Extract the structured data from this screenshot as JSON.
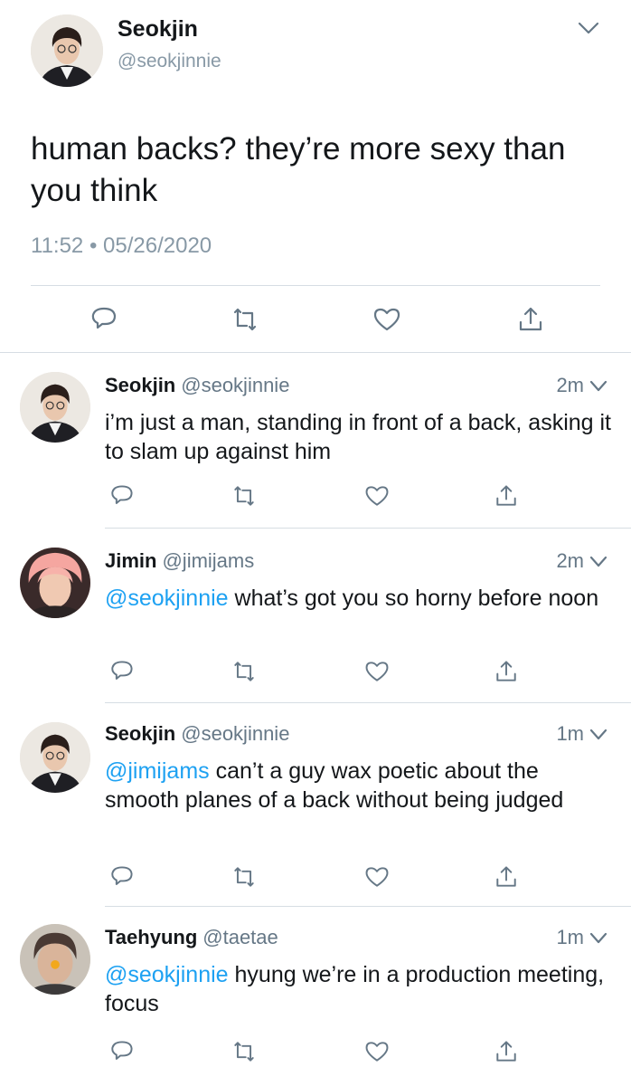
{
  "main_tweet": {
    "name": "Seokjin",
    "handle": "@seokjinnie",
    "text": "human backs? they’re more sexy than you think",
    "timestamp": "11:52 • 05/26/2020",
    "avatar_icon": "avatar-seokjin"
  },
  "replies": [
    {
      "name": "Seokjin",
      "handle": "@seokjinnie",
      "time": "2m",
      "mention": "",
      "text": "i’m just a man, standing in front of a back, asking it to slam up against him",
      "avatar_icon": "avatar-seokjin"
    },
    {
      "name": "Jimin",
      "handle": "@jimijams",
      "time": "2m",
      "mention": "@seokjinnie",
      "text": " what’s got you so horny before noon",
      "avatar_icon": "avatar-jimin"
    },
    {
      "name": "Seokjin",
      "handle": "@seokjinnie",
      "time": "1m",
      "mention": "@jimijams",
      "text": " can’t a guy wax poetic about the smooth planes of a back without being judged",
      "avatar_icon": "avatar-seokjin"
    },
    {
      "name": "Taehyung",
      "handle": "@taetae",
      "time": "1m",
      "mention": "@seokjinnie",
      "text": " hyung we’re in a production meeting, focus",
      "avatar_icon": "avatar-taehyung"
    }
  ],
  "icons": {
    "reply": "reply-icon",
    "retweet": "retweet-icon",
    "like": "like-icon",
    "share": "share-icon",
    "menu": "chevron-down-icon"
  },
  "colors": {
    "mention": "#1da1f2",
    "secondary_text": "#657786",
    "divider": "#d6dde3"
  }
}
